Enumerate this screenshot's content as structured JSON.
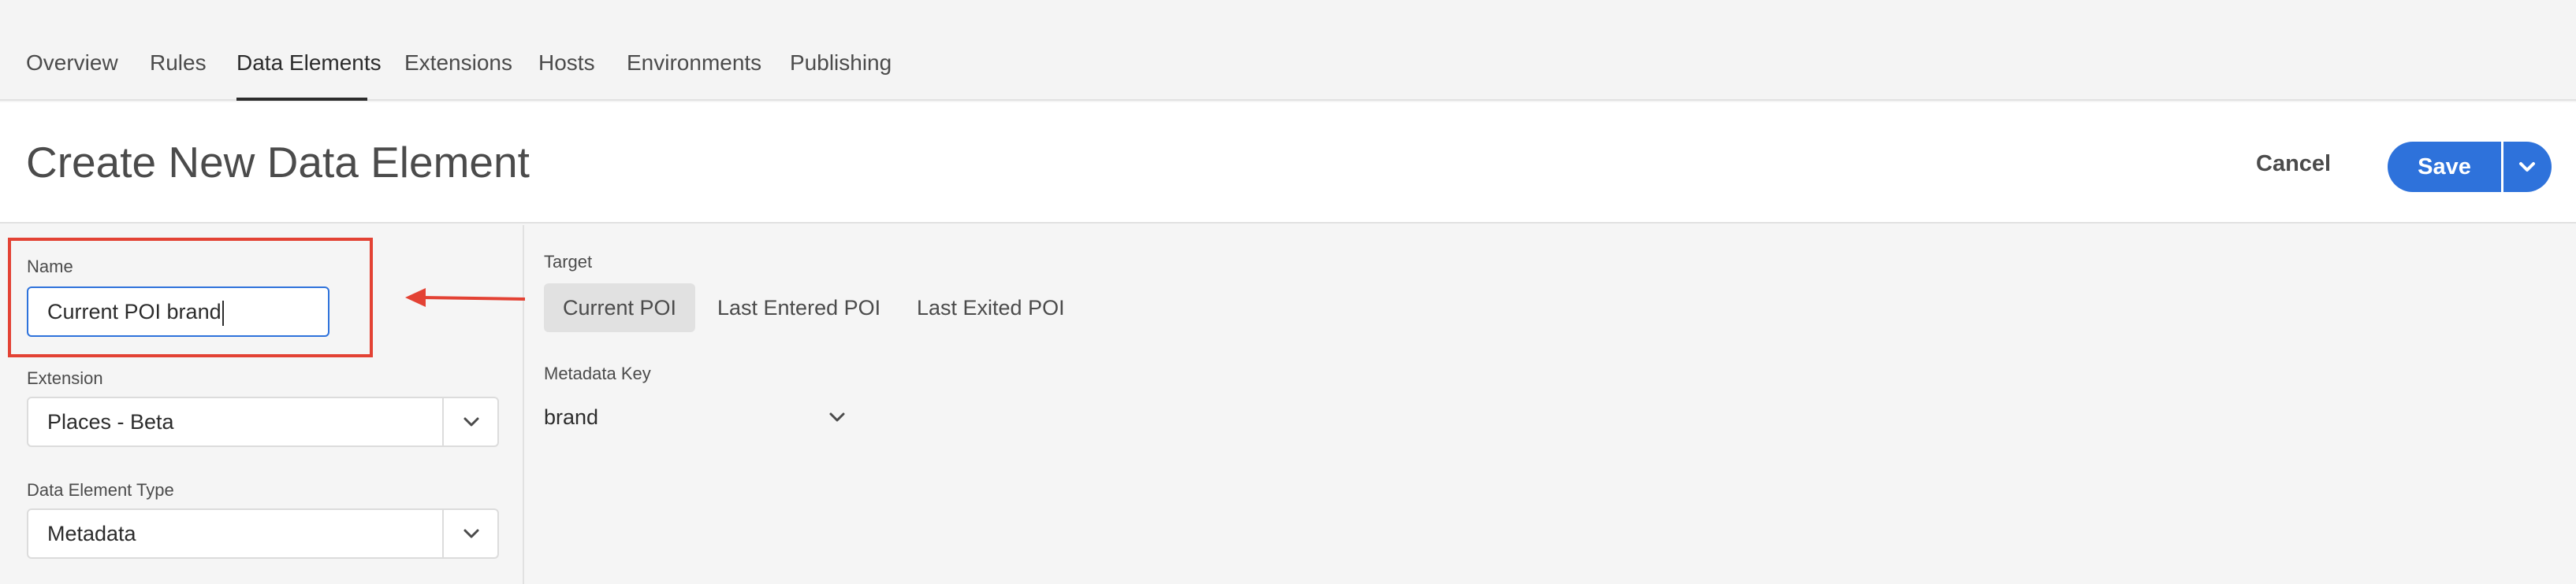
{
  "nav": {
    "tabs": [
      {
        "label": "Overview"
      },
      {
        "label": "Rules"
      },
      {
        "label": "Data Elements"
      },
      {
        "label": "Extensions"
      },
      {
        "label": "Hosts"
      },
      {
        "label": "Environments"
      },
      {
        "label": "Publishing"
      }
    ],
    "active_tab": "Data Elements"
  },
  "header": {
    "title": "Create New Data Element",
    "cancel_label": "Cancel",
    "save_label": "Save"
  },
  "form": {
    "name_label": "Name",
    "name_value": "Current POI brand",
    "extension_label": "Extension",
    "extension_value": "Places - Beta",
    "type_label": "Data Element Type",
    "type_value": "Metadata"
  },
  "config": {
    "target_label": "Target",
    "target_options": [
      {
        "label": "Current POI"
      },
      {
        "label": "Last Entered POI"
      },
      {
        "label": "Last Exited POI"
      }
    ],
    "selected_target": "Current POI",
    "metadata_key_label": "Metadata Key",
    "metadata_key_value": "brand"
  },
  "colors": {
    "accent": "#2e72db",
    "annotation": "#e34234"
  }
}
